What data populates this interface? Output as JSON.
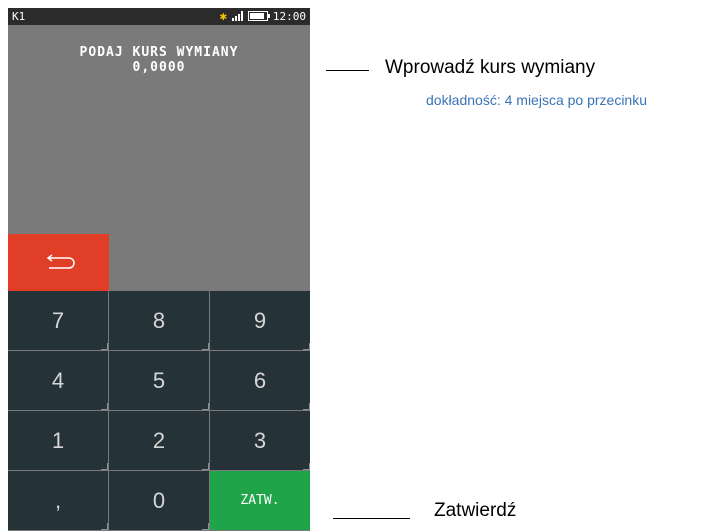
{
  "status": {
    "left_label": "K1",
    "bluetooth_symbol": "✱",
    "time": "12:00"
  },
  "screen": {
    "prompt_title": "PODAJ KURS WYMIANY",
    "prompt_value": "0,0000"
  },
  "back_button": {
    "icon": "back-arrow-icon"
  },
  "keypad": {
    "keys": [
      "7",
      "8",
      "9",
      "4",
      "5",
      "6",
      "1",
      "2",
      "3",
      ",",
      "0",
      "ZATW."
    ]
  },
  "annotations": {
    "enter_rate": "Wprowadź kurs wymiany",
    "precision_note": "dokładność: 4 miejsca po przecinku",
    "confirm": "Zatwierdź"
  },
  "colors": {
    "status_bar": "#2b2b2b",
    "display_bg": "#7a7a7a",
    "back_button": "#e13e27",
    "key_bg": "#253238",
    "confirm_key": "#1fa44a",
    "note_text": "#3a73b8",
    "bluetooth": "#f2c600"
  }
}
